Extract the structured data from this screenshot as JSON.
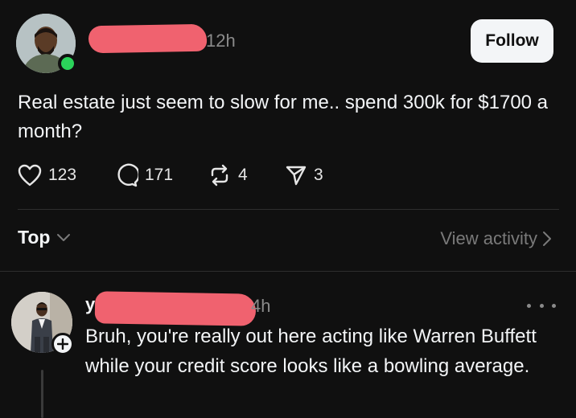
{
  "post": {
    "time": "12h",
    "follow_label": "Follow",
    "text": "Real estate just seem to slow for me.. spend 300k for $1700 a month?",
    "actions": {
      "likes": "123",
      "replies": "171",
      "reposts": "4",
      "shares": "3"
    }
  },
  "sort": {
    "label": "Top",
    "view_activity_label": "View activity"
  },
  "reply": {
    "username_visible": "y",
    "time": "4h",
    "text": "Bruh, you're really out here acting like Warren Buffett while your credit score looks like a bowling average."
  },
  "icons": {
    "like": "heart-icon",
    "reply": "comment-icon",
    "repost": "repost-icon",
    "share": "send-icon",
    "sort_toggle": "chevron-down-icon",
    "view_activity": "chevron-right-icon",
    "more": "more-horizontal-icon",
    "add": "plus-icon"
  },
  "colors": {
    "background": "#101010",
    "text": "#f3f5f7",
    "muted": "#8a8a8a",
    "online": "#2bd35a",
    "redaction": "#f0626f"
  }
}
